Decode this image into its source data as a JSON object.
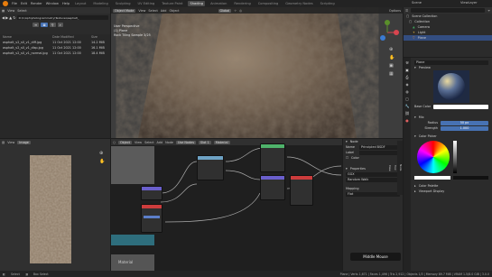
{
  "topbar": {
    "menus": [
      "File",
      "Edit",
      "Render",
      "Window",
      "Help"
    ],
    "workspaces": [
      "Layout",
      "Modeling",
      "Sculpting",
      "UV Editing",
      "Texture Paint",
      "Shading",
      "Animation",
      "Rendering",
      "Compositing",
      "Geometry Nodes",
      "Scripting"
    ],
    "active_workspace": "Shading",
    "scene": "Scene",
    "view_layer": "ViewLayer"
  },
  "file_browser": {
    "menus": [
      "View",
      "Select"
    ],
    "path": "D:\\1\\Aph\\photogrammetry\\Textures\\asphalt_",
    "columns": [
      "Name",
      "Date Modified",
      "Size"
    ],
    "files": [
      {
        "name": "asphalt_v2_s0_v1_diff.jpg",
        "date": "11 Oct 2021 12:00",
        "size": "14.2 MiB"
      },
      {
        "name": "asphalt_v2_s0_v1_disp.jpg",
        "date": "11 Oct 2021 12:00",
        "size": "16.1 MiB"
      },
      {
        "name": "asphalt_v2_s0_v1_normal.jpg",
        "date": "11 Oct 2021 12:00",
        "size": "18.4 MiB"
      }
    ]
  },
  "viewport": {
    "mode": "Object Mode",
    "menus": [
      "View",
      "Select",
      "Add",
      "Object"
    ],
    "shading": "Global",
    "overlay_title": "User Perspective",
    "overlay_sub": "(1) Plane",
    "overlay_tex": "Rock Tiling Sample 3/25",
    "options": "Options"
  },
  "outliner": {
    "title": "Scene Collection",
    "items": [
      "Collection",
      "Camera",
      "Light",
      "Plane"
    ],
    "search_placeholder": ""
  },
  "properties": {
    "material": "Plane",
    "preview": "Preview",
    "base_color_label": "Base Color",
    "strength_label": "Strength",
    "mix_label": "Mix",
    "radius_label": "Radius",
    "radius_value": "50 px",
    "strength_value": "1.000",
    "color_picker": "Color Picker",
    "color_palette": "Color Palette",
    "viewport_display": "Viewport Display"
  },
  "image_editor": {
    "menus": [
      "View"
    ],
    "title": "Image"
  },
  "node_editor": {
    "menus": [
      "Object",
      "View",
      "Select",
      "Add",
      "Node"
    ],
    "slot": "Slot 1",
    "material": "Material",
    "use_nodes": "Use Nodes",
    "nodes": [
      "Image Texture",
      "Principled BSDF",
      "Mapping",
      "Texture Coordinate",
      "Material Output",
      "Displacement"
    ]
  },
  "node_sidebar": {
    "title": "Node",
    "name_label": "Name",
    "name_value": "Principled BSDF",
    "label_label": "Label",
    "color_label": "Color",
    "properties": "Properties",
    "distribution": "GGX",
    "subsurface": "Random Walk",
    "tab_node": "Node",
    "tab_tool": "Tool",
    "tab_view": "View"
  },
  "textures_panel": {
    "label": "Mapping",
    "value": "Flat"
  },
  "bottom_left": {
    "label": "Material"
  },
  "hint": "Middle Mouse",
  "statusbar": {
    "left": "Select",
    "mid": "Box Select",
    "right": "Plane | Verts 1,671 | Faces 1,496 | Tris 2,912 | Objects 1/3 | Memory 89.7 MiB | VRAM 1.5/8.0 GiB | 3.0.0"
  },
  "accent_colors": {
    "orange": "#e87d0d",
    "blue": "#4772b3",
    "image_header": "#6da2c4",
    "shader_header": "#4fb36b",
    "vector_header": "#6a5fcc"
  }
}
